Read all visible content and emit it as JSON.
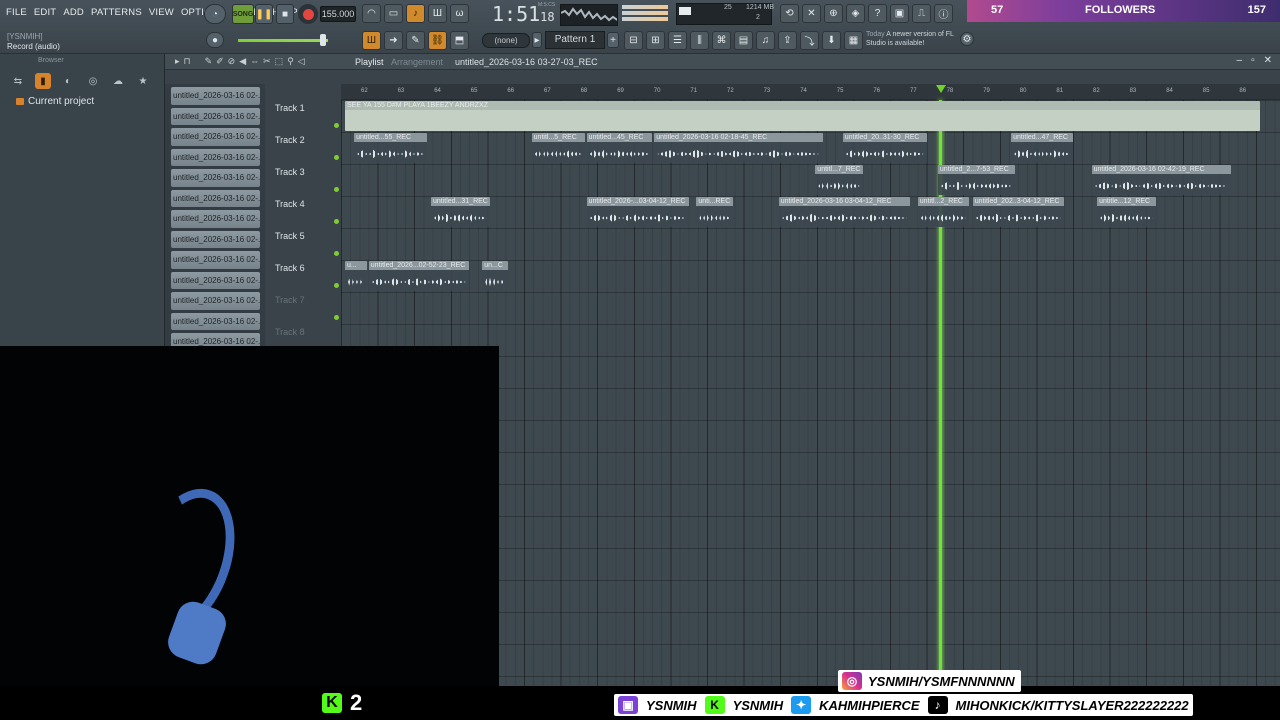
{
  "menu": [
    "FILE",
    "EDIT",
    "ADD",
    "PATTERNS",
    "VIEW",
    "OPTIONS",
    "TOOLS",
    "HELP"
  ],
  "hint": {
    "line1": "[YSNMIH]",
    "line2": "Record (audio)"
  },
  "transport": {
    "song_label": "SONG",
    "tempo": "155.000",
    "time_main": "1:51",
    "time_sub": "18",
    "time_label": "M:S:CS"
  },
  "cpu": {
    "value1": "25",
    "memory": "1214 MB",
    "value2": "2"
  },
  "news": {
    "when": "Today",
    "text": "A newer version of FL Studio is available!"
  },
  "pattern_selector": {
    "value": "Pattern 1",
    "none_label": "(none)"
  },
  "followers": {
    "count": "57",
    "label": "FOLLOWERS",
    "goal": "157"
  },
  "browser": {
    "title": "Browser",
    "item": "Current project"
  },
  "playlist": {
    "title": "Playlist",
    "subtitle": "Arrangement",
    "file": "untitled_2026-03-16 03-27-03_REC",
    "patterns": [
      "untitled_2026-03-16 02-...",
      "untitled_2026-03-16 02-...",
      "untitled_2026-03-16 02-...",
      "untitled_2026-03-16 02-...",
      "untitled_2026-03-16 02-...",
      "untitled_2026-03-16 02-...",
      "untitled_2026-03-16 02-...",
      "untitled_2026-03-16 02-...",
      "untitled_2026-03-16 02-...",
      "untitled_2026-03-16 02-...",
      "untitled_2026-03-16 02-...",
      "untitled_2026-03-16 02-...",
      "untitled_2026-03-16 02-..."
    ],
    "tracks": [
      "Track 1",
      "Track 2",
      "Track 3",
      "Track 4",
      "Track 5",
      "Track 6",
      "Track 7",
      "Track 8"
    ],
    "bars": [
      "62",
      "63",
      "64",
      "65",
      "66",
      "67",
      "68",
      "69",
      "70",
      "71",
      "72",
      "73",
      "74",
      "75",
      "76",
      "77",
      "78",
      "79",
      "80",
      "81",
      "82",
      "83",
      "84",
      "85",
      "86"
    ],
    "clips": [
      {
        "track": 0,
        "start": 0.0,
        "len": 25.0,
        "label": "SEE YA 155 D#M PLAYA 1BEEZY ANDRZXZ",
        "style": "light"
      },
      {
        "track": 1,
        "start": 0.25,
        "len": 2.0,
        "label": "untitled...55_REC"
      },
      {
        "track": 1,
        "start": 5.1,
        "len": 1.45,
        "label": "untitl...5_REC"
      },
      {
        "track": 1,
        "start": 6.6,
        "len": 1.8,
        "label": "untitled...45_REC"
      },
      {
        "track": 1,
        "start": 8.45,
        "len": 4.6,
        "label": "untitled_2026-03-16 02-18-45_REC"
      },
      {
        "track": 1,
        "start": 13.6,
        "len": 2.3,
        "label": "untitled_20..31-30_REC"
      },
      {
        "track": 1,
        "start": 18.2,
        "len": 1.7,
        "label": "untitled...47_REC"
      },
      {
        "track": 2,
        "start": 12.85,
        "len": 1.3,
        "label": "untitl...7_REC"
      },
      {
        "track": 2,
        "start": 16.2,
        "len": 2.1,
        "label": "untitled_2...7-53_REC"
      },
      {
        "track": 2,
        "start": 20.4,
        "len": 3.8,
        "label": "untitled_2026-03-16 02-42-19_REC"
      },
      {
        "track": 3,
        "start": 2.35,
        "len": 1.6,
        "label": "untitled...31_REC"
      },
      {
        "track": 3,
        "start": 6.6,
        "len": 2.8,
        "label": "untitled_2026-...03-04-12_REC"
      },
      {
        "track": 3,
        "start": 9.6,
        "len": 1.0,
        "label": "unti...REC"
      },
      {
        "track": 3,
        "start": 11.85,
        "len": 3.6,
        "label": "untitled_2026-03-16 03-04-12_REC"
      },
      {
        "track": 3,
        "start": 15.65,
        "len": 1.4,
        "label": "untitl...2_REC"
      },
      {
        "track": 3,
        "start": 17.15,
        "len": 2.5,
        "label": "untitled_202..3-04-12_REC"
      },
      {
        "track": 3,
        "start": 20.55,
        "len": 1.6,
        "label": "untitle...12_REC"
      },
      {
        "track": 5,
        "start": 0.0,
        "len": 0.6,
        "label": "u..."
      },
      {
        "track": 5,
        "start": 0.65,
        "len": 2.75,
        "label": "untitled_2026...02-52-23_REC"
      },
      {
        "track": 5,
        "start": 3.75,
        "len": 0.7,
        "label": "un...C"
      }
    ],
    "playhead_bar": "72.9"
  },
  "kick_count": "2",
  "socials": {
    "instagram": "YSNMIH/YSMFNNNNNN",
    "twitch": "YSNMIH",
    "kick": "YSNMIH",
    "twitter": "KAHMIHPIERCE",
    "tiktok": "MIHONKICK/KITTYSLAYER222222222"
  }
}
